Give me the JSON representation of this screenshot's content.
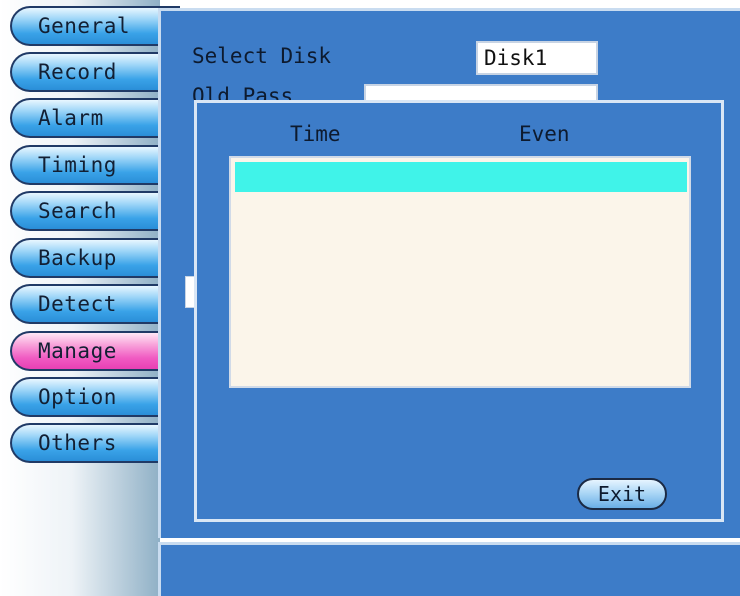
{
  "sidebar": {
    "items": [
      {
        "label": "General"
      },
      {
        "label": "Record"
      },
      {
        "label": "Alarm"
      },
      {
        "label": "Timing"
      },
      {
        "label": "Search"
      },
      {
        "label": "Backup"
      },
      {
        "label": "Detect"
      },
      {
        "label": "Manage"
      },
      {
        "label": "Option"
      },
      {
        "label": "Others"
      }
    ],
    "active": "Manage"
  },
  "manage": {
    "select_disk_label": "Select Disk",
    "select_disk_value": "Disk1",
    "old_pass_label": "Old Pass",
    "old_pass_value": ""
  },
  "log_dialog": {
    "columns": [
      "Time",
      "Even"
    ],
    "rows": [],
    "exit_label": "Exit"
  },
  "status_bar": {
    "text": ""
  },
  "colors": {
    "panel_bg": "#3d7cc8",
    "nav_normal": "#3aa3e8",
    "nav_active": "#f05ac2",
    "list_bg": "#fbf5ea",
    "list_selection": "#40f3e9"
  }
}
